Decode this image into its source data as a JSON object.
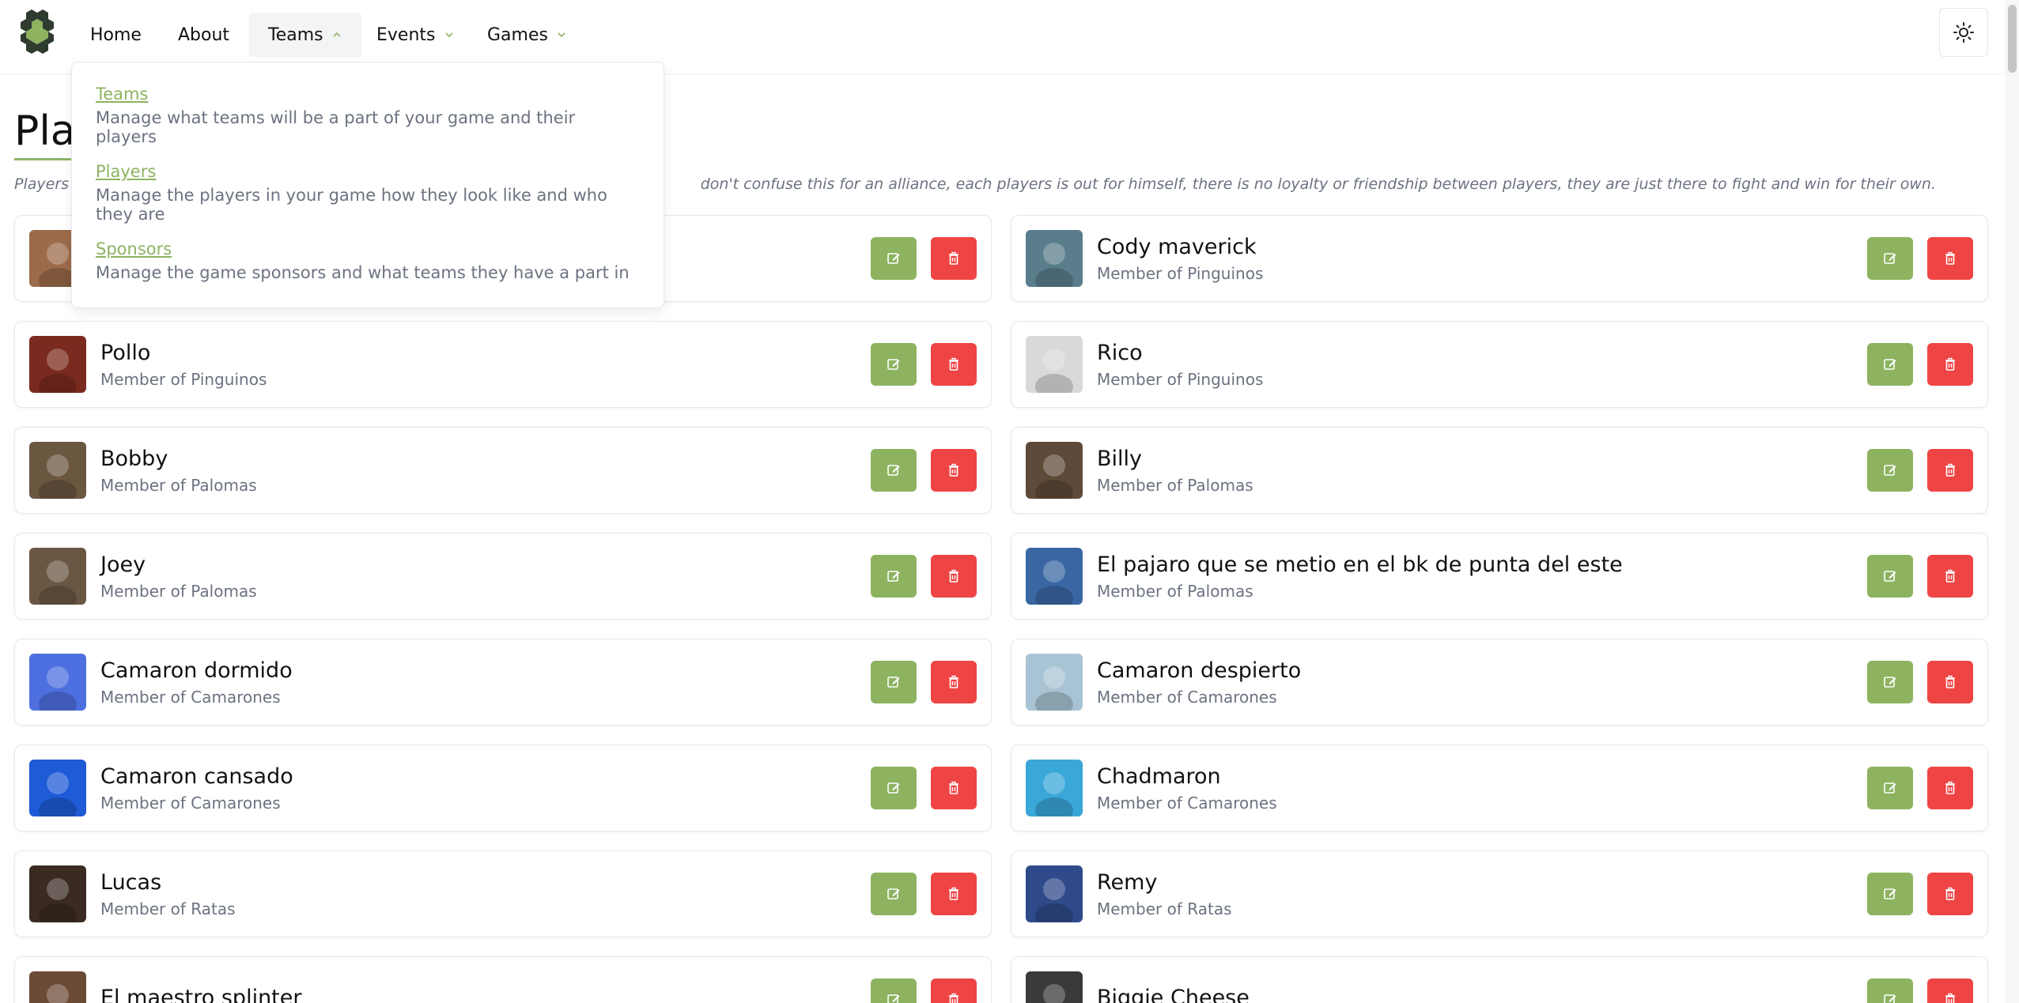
{
  "nav": {
    "items": [
      {
        "label": "Home"
      },
      {
        "label": "About"
      },
      {
        "label": "Teams"
      },
      {
        "label": "Events"
      },
      {
        "label": "Games"
      }
    ]
  },
  "teams_dropdown": [
    {
      "title": "Teams",
      "description": "Manage what teams will be a part of your game and their players"
    },
    {
      "title": "Players",
      "description": "Manage the players in your game how they look like and who they are"
    },
    {
      "title": "Sponsors",
      "description": "Manage the game sponsors and what teams they have a part in"
    }
  ],
  "page": {
    "title": "Play",
    "description_visible_start": "Players a",
    "description_visible_end": "don't confuse this for an alliance, each players is out for himself, there is no loyalty or friendship between players, they are just there to fight and win for their own."
  },
  "players": [
    {
      "name": "",
      "team": "",
      "color": "#9c6b4a"
    },
    {
      "name": "Cody maverick",
      "team": "Member of Pinguinos",
      "color": "#5a7d8c"
    },
    {
      "name": "Pollo",
      "team": "Member of Pinguinos",
      "color": "#7a2a1e"
    },
    {
      "name": "Rico",
      "team": "Member of Pinguinos",
      "color": "#d9d9d9"
    },
    {
      "name": "Bobby",
      "team": "Member of Palomas",
      "color": "#6b5640"
    },
    {
      "name": "Billy",
      "team": "Member of Palomas",
      "color": "#5e4a38"
    },
    {
      "name": "Joey",
      "team": "Member of Palomas",
      "color": "#6a5743"
    },
    {
      "name": "El pajaro que se metio en el bk de punta del este",
      "team": "Member of Palomas",
      "color": "#3a67a3"
    },
    {
      "name": "Camaron dormido",
      "team": "Member of Camarones",
      "color": "#4d6fe0"
    },
    {
      "name": "Camaron despierto",
      "team": "Member of Camarones",
      "color": "#a8c4d4"
    },
    {
      "name": "Camaron cansado",
      "team": "Member of Camarones",
      "color": "#1e5bd6"
    },
    {
      "name": "Chadmaron",
      "team": "Member of Camarones",
      "color": "#3aa7d9"
    },
    {
      "name": "Lucas",
      "team": "Member of Ratas",
      "color": "#3a2a22"
    },
    {
      "name": "Remy",
      "team": "Member of Ratas",
      "color": "#2e4a8a"
    },
    {
      "name": "El maestro splinter",
      "team": "",
      "color": "#6b4a36"
    },
    {
      "name": "Biggie Cheese",
      "team": "",
      "color": "#3a3a3a"
    }
  ]
}
